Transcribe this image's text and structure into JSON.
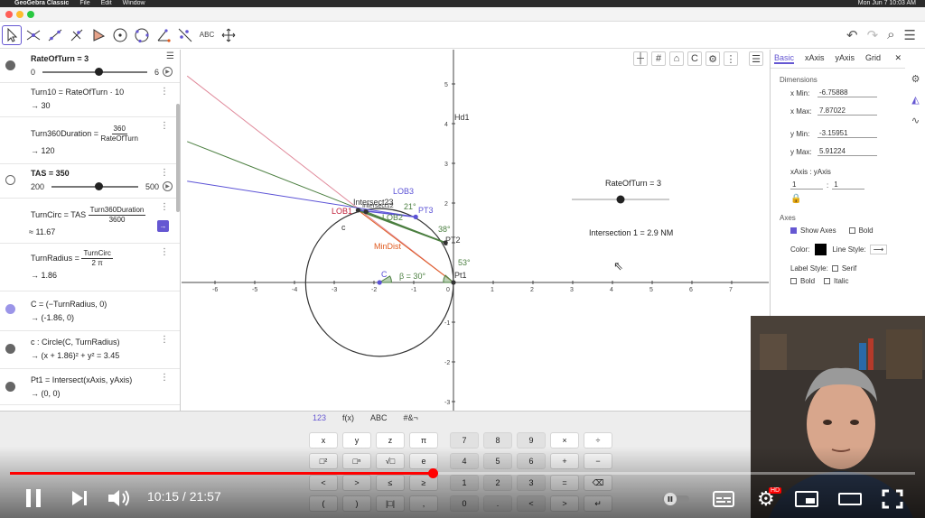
{
  "menubar": {
    "app_name": "GeoGebra Classic",
    "menus": [
      "File",
      "Edit",
      "Window"
    ],
    "clock": "Mon Jun 7  10:03 AM"
  },
  "toolbar": {
    "tools": [
      {
        "name": "move-tool",
        "label": ""
      },
      {
        "name": "point-on-object-tool",
        "label": ""
      },
      {
        "name": "line-tool",
        "label": ""
      },
      {
        "name": "perpendicular-tool",
        "label": ""
      },
      {
        "name": "polygon-tool",
        "label": ""
      },
      {
        "name": "circle-tool",
        "label": ""
      },
      {
        "name": "circle-three-points-tool",
        "label": ""
      },
      {
        "name": "angle-tool",
        "label": ""
      },
      {
        "name": "reflect-tool",
        "label": ""
      },
      {
        "name": "text-tool",
        "label": "ABC"
      },
      {
        "name": "move-graphics-tool",
        "label": ""
      }
    ]
  },
  "algebra": {
    "rate_of_turn": {
      "label": "RateOfTurn = 3",
      "min": "0",
      "max": "6",
      "value": 3
    },
    "turn10": {
      "def": "Turn10  =  RateOfTurn · 10",
      "out": "→  30"
    },
    "turn360": {
      "lhs": "Turn360Duration  =",
      "num": "360",
      "den": "RateOfTurn",
      "out": "→  120"
    },
    "tas": {
      "label": "TAS = 350",
      "min": "200",
      "max": "500",
      "value": 350
    },
    "turn_circ": {
      "lhs": "TurnCirc  =  TAS",
      "num": "Turn360Duration",
      "den": "3600",
      "out": "≈ 11.67"
    },
    "turn_radius": {
      "lhs": "TurnRadius  =",
      "num": "TurnCirc",
      "den": "2 π",
      "out": "→  1.86"
    },
    "c_point": {
      "def": "C  =  (−TurnRadius, 0)",
      "out": "→  (-1.86, 0)"
    },
    "circle": {
      "def": "c : Circle(C, TurnRadius)",
      "out": "→  (x + 1.86)² + y² = 3.45"
    },
    "pt1": {
      "def": "Pt1  =  Intersect(xAxis, yAxis)",
      "out": "→  (0, 0)"
    }
  },
  "graphics": {
    "x_ticks": [
      "-6",
      "-5",
      "-4",
      "-3",
      "-2",
      "-1",
      "0",
      "1",
      "2",
      "3",
      "4",
      "5",
      "6",
      "7"
    ],
    "y_ticks": [
      "5",
      "4",
      "3",
      "2",
      "1",
      "-1",
      "-2",
      "-3"
    ],
    "labels": {
      "hd1": "Hd1",
      "lob3": "LOB3",
      "lob2": "LOB2",
      "lob1": "LOB1",
      "intersect23": "Intersect23",
      "intersect12": "Intersect12",
      "pt3": "PT3",
      "pt2": "PT2",
      "pt1": "Pt1",
      "c_label": "c",
      "c_point": "C",
      "mindist": "MinDist",
      "angle21": "21°",
      "angle38": "38°",
      "angle53": "53°",
      "beta": "β = 30°"
    },
    "slider_label": "RateOfTurn = 3",
    "intersection_text": "Intersection 1 = 2.9 NM"
  },
  "props": {
    "tabs": [
      "Basic",
      "xAxis",
      "yAxis",
      "Grid"
    ],
    "dimensions_title": "Dimensions",
    "x_min": {
      "label": "x Min:",
      "value": "-6.75888"
    },
    "x_max": {
      "label": "x Max:",
      "value": "7.87022"
    },
    "y_min": {
      "label": "y Min:",
      "value": "-3.15951"
    },
    "y_max": {
      "label": "y Max:",
      "value": "5.91224"
    },
    "ratio_label": "xAxis : yAxis",
    "ratio_a": "1",
    "ratio_b": "1",
    "axes_title": "Axes",
    "show_axes": "Show Axes",
    "bold": "Bold",
    "color_label": "Color:",
    "line_style_label": "Line Style:",
    "label_style": "Label Style:",
    "serif": "Serif",
    "bold2": "Bold",
    "italic": "Italic"
  },
  "keyboard": {
    "tabs": [
      "123",
      "f(x)",
      "ABC",
      "#&¬"
    ],
    "keys": [
      [
        "x",
        "y",
        "z",
        "π",
        "7",
        "8",
        "9",
        "×",
        "÷"
      ],
      [
        "□²",
        "□ⁿ",
        "√□",
        "e",
        "4",
        "5",
        "6",
        "+",
        "−"
      ],
      [
        "<",
        ">",
        "≤",
        "≥",
        "1",
        "2",
        "3",
        "=",
        "⌫"
      ],
      [
        "(",
        ")",
        "|□|",
        ",",
        "0",
        ".",
        "<",
        ">",
        "↵"
      ]
    ]
  },
  "video": {
    "time": "10:15 / 21:57",
    "progress": 0.467,
    "hd_badge": "HD"
  },
  "colors": {
    "accent": "#6557d2",
    "red_line": "#e08a9b",
    "green_line": "#4a7e3f",
    "blue_line": "#5b52d6",
    "orange_line": "#e05a1e",
    "progress": "#ff0000"
  }
}
